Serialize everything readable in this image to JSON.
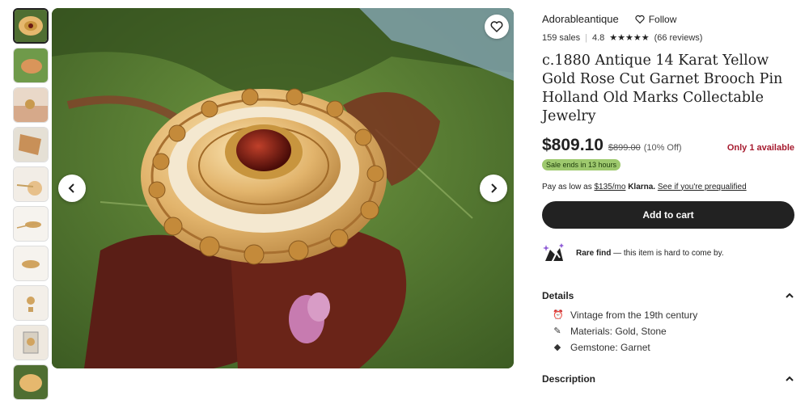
{
  "shop": {
    "name": "Adorableantique",
    "follow_label": "Follow",
    "sales": "159 sales",
    "rating": "4.8",
    "stars": "★★★★★",
    "reviews": "(66 reviews)"
  },
  "listing": {
    "title": "c.1880 Antique 14 Karat Yellow Gold Rose Cut Garnet Brooch Pin Holland Old Marks Collectable Jewelry",
    "price": "$809.10",
    "original_price": "$899.00",
    "discount": "(10% Off)",
    "availability": "Only 1 available",
    "sale_badge": "Sale ends in 13 hours"
  },
  "klarna": {
    "prefix": "Pay as low as",
    "amount": "$135/mo",
    "brand": "Klarna.",
    "link": "See if you're prequalified"
  },
  "cart_button": "Add to cart",
  "rare_find": {
    "bold": "Rare find",
    "text": " — this item is hard to come by."
  },
  "details": {
    "heading": "Details",
    "items": [
      {
        "icon": "vintage-icon",
        "label": "Vintage from the 19th century"
      },
      {
        "icon": "materials-icon",
        "label": "Materials: Gold, Stone"
      },
      {
        "icon": "gemstone-icon",
        "label": "Gemstone: Garnet"
      }
    ]
  },
  "description": {
    "heading": "Description"
  },
  "gallery": {
    "thumbnail_count": 10,
    "active_index": 0
  },
  "colors": {
    "price_accent": "#a61a2e",
    "sale_badge": "#9ec96e",
    "cart_button": "#222222"
  }
}
